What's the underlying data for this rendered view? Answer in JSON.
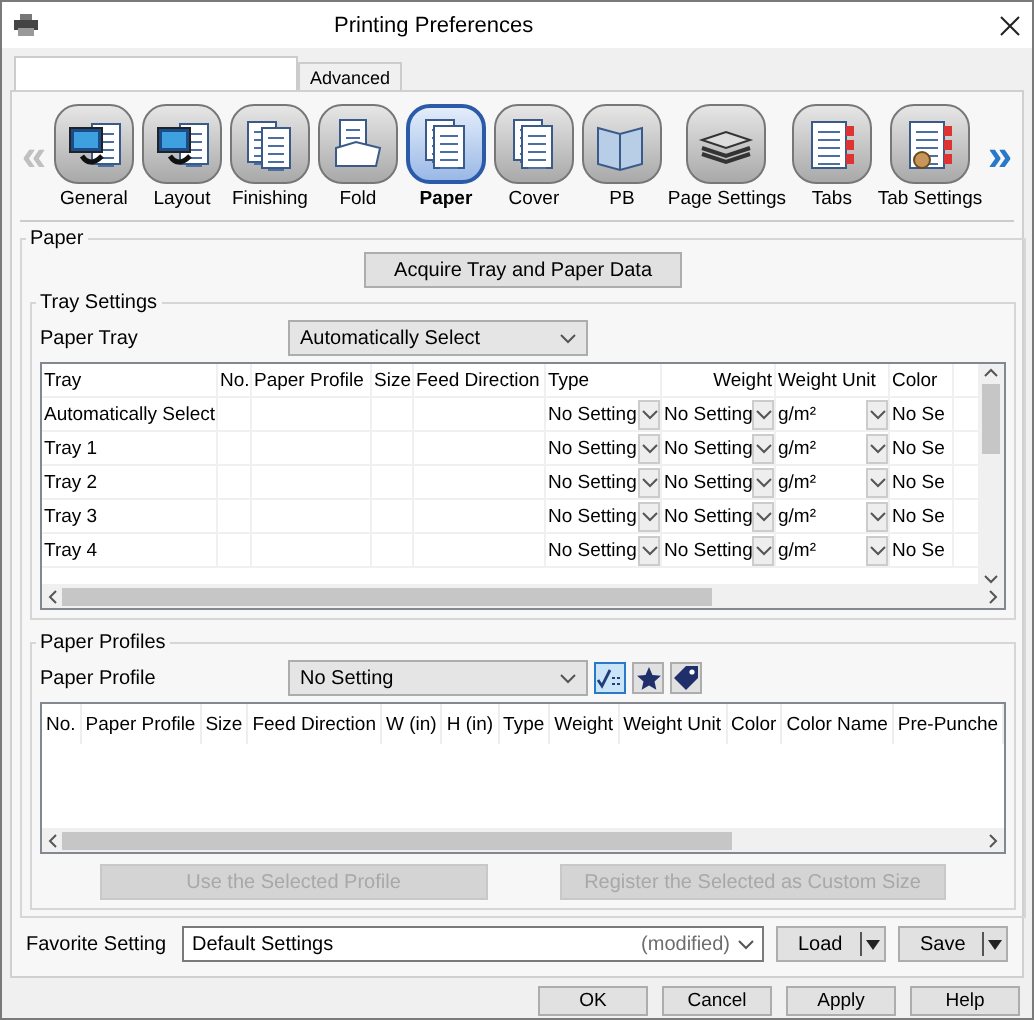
{
  "window": {
    "title": "Printing Preferences"
  },
  "tabs": [
    {
      "selected": true
    },
    {
      "label": "Advanced",
      "selected": false
    }
  ],
  "toolbar": {
    "back": {
      "label": "«",
      "disabled": true
    },
    "forward": {
      "label": "»",
      "disabled": false
    },
    "items": [
      {
        "label": "General",
        "selected": false
      },
      {
        "label": "Layout",
        "selected": false
      },
      {
        "label": "Finishing",
        "selected": false
      },
      {
        "label": "Fold",
        "selected": false
      },
      {
        "label": "Paper",
        "selected": true
      },
      {
        "label": "Cover",
        "selected": false
      },
      {
        "label": "PB",
        "selected": false
      },
      {
        "label": "Page Settings",
        "selected": false
      },
      {
        "label": "Tabs",
        "selected": false
      },
      {
        "label": "Tab Settings",
        "selected": false
      }
    ]
  },
  "paper": {
    "title": "Paper",
    "acquire_button": "Acquire Tray and Paper Data",
    "tray_settings": {
      "title": "Tray Settings",
      "paper_tray": {
        "label": "Paper Tray",
        "value": "Automatically Select"
      },
      "table": {
        "columns": [
          {
            "label": "Tray",
            "kind": "text"
          },
          {
            "label": "No.",
            "kind": "text"
          },
          {
            "label": "Paper Profile",
            "kind": "text"
          },
          {
            "label": "Size",
            "kind": "text"
          },
          {
            "label": "Feed Direction",
            "kind": "text"
          },
          {
            "label": "Type",
            "kind": "dropdown"
          },
          {
            "label": "Weight",
            "kind": "dropdown"
          },
          {
            "label": "Weight Unit",
            "kind": "dropdown"
          },
          {
            "label": "Color",
            "kind": "text"
          }
        ],
        "rows": [
          {
            "cells": [
              "Automatically Select",
              "",
              "",
              "",
              "",
              "No Setting",
              "No Setting",
              "g/m²",
              "No Se"
            ]
          },
          {
            "cells": [
              "Tray 1",
              "",
              "",
              "",
              "",
              "No Setting",
              "No Setting",
              "g/m²",
              "No Se"
            ]
          },
          {
            "cells": [
              "Tray 2",
              "",
              "",
              "",
              "",
              "No Setting",
              "No Setting",
              "g/m²",
              "No Se"
            ]
          },
          {
            "cells": [
              "Tray 3",
              "",
              "",
              "",
              "",
              "No Setting",
              "No Setting",
              "g/m²",
              "No Se"
            ]
          },
          {
            "cells": [
              "Tray 4",
              "",
              "",
              "",
              "",
              "No Setting",
              "No Setting",
              "g/m²",
              "No Se"
            ]
          }
        ]
      }
    },
    "paper_profiles": {
      "title": "Paper Profiles",
      "paper_profile": {
        "label": "Paper Profile",
        "value": "No Setting"
      },
      "tool_buttons": [
        {
          "selected": true
        },
        {
          "selected": false
        },
        {
          "selected": false
        }
      ],
      "table": {
        "columns": [
          "No.",
          "Paper Profile",
          "Size",
          "Feed Direction",
          "W (in)",
          "H (in)",
          "Type",
          "Weight",
          "Weight Unit",
          "Color",
          "Color Name",
          "Pre-Punche"
        ]
      },
      "buttons": [
        {
          "label": "Use the Selected Profile",
          "disabled": true
        },
        {
          "label": "Register the Selected as Custom Size",
          "disabled": true
        }
      ]
    }
  },
  "favorite": {
    "label": "Favorite Setting",
    "value": "Default Settings",
    "note": "(modified)",
    "buttons": [
      "Load",
      "Save"
    ]
  },
  "footer_buttons": [
    "OK",
    "Cancel",
    "Apply",
    "Help"
  ]
}
